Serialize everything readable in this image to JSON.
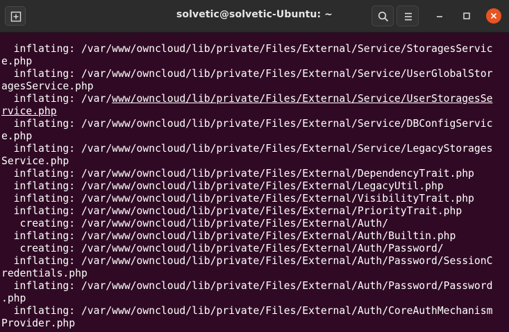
{
  "window": {
    "title": "solvetic@solvetic-Ubuntu: ~"
  },
  "colors": {
    "terminal_bg": "#300a24",
    "titlebar_bg": "#2c2c2c",
    "close_button": "#e95420",
    "text": "#ffffff"
  },
  "icons": {
    "new_tab": "new-tab-icon",
    "search": "search-icon",
    "menu": "hamburger-menu-icon",
    "minimize": "minimize-icon",
    "maximize": "maximize-icon",
    "close": "close-icon"
  },
  "terminal": {
    "lines": [
      {
        "text": "  inflating: /var/www/owncloud/lib/private/Files/External/Service/StoragesServic"
      },
      {
        "text": "e.php"
      },
      {
        "text": "  inflating: /var/www/owncloud/lib/private/Files/External/Service/UserGlobalStor"
      },
      {
        "text": "agesService.php"
      },
      {
        "pre": "  inflating: /var/",
        "link": "www/owncloud/lib/private/Files/External/Service/UserStoragesSe"
      },
      {
        "pre": "",
        "link": "rvice.php"
      },
      {
        "text": "  inflating: /var/www/owncloud/lib/private/Files/External/Service/DBConfigServic"
      },
      {
        "text": "e.php"
      },
      {
        "text": "  inflating: /var/www/owncloud/lib/private/Files/External/Service/LegacyStorages"
      },
      {
        "text": "Service.php"
      },
      {
        "text": "  inflating: /var/www/owncloud/lib/private/Files/External/DependencyTrait.php"
      },
      {
        "text": "  inflating: /var/www/owncloud/lib/private/Files/External/LegacyUtil.php"
      },
      {
        "text": "  inflating: /var/www/owncloud/lib/private/Files/External/VisibilityTrait.php"
      },
      {
        "text": "  inflating: /var/www/owncloud/lib/private/Files/External/PriorityTrait.php"
      },
      {
        "text": "   creating: /var/www/owncloud/lib/private/Files/External/Auth/"
      },
      {
        "text": "  inflating: /var/www/owncloud/lib/private/Files/External/Auth/Builtin.php"
      },
      {
        "text": "   creating: /var/www/owncloud/lib/private/Files/External/Auth/Password/"
      },
      {
        "text": "  inflating: /var/www/owncloud/lib/private/Files/External/Auth/Password/SessionC"
      },
      {
        "text": "redentials.php"
      },
      {
        "text": "  inflating: /var/www/owncloud/lib/private/Files/External/Auth/Password/Password"
      },
      {
        "text": ".php"
      },
      {
        "text": "  inflating: /var/www/owncloud/lib/private/Files/External/Auth/CoreAuthMechanism"
      },
      {
        "text": "Provider.php"
      }
    ]
  }
}
